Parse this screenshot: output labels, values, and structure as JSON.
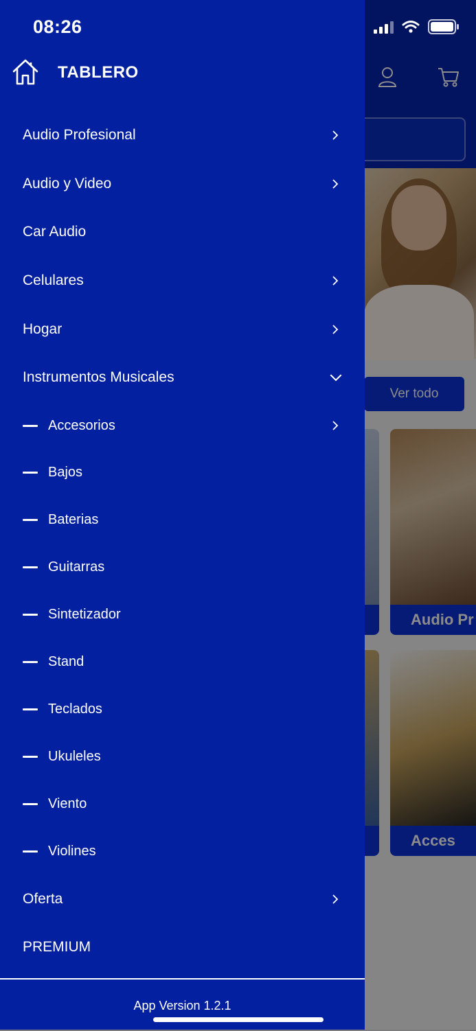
{
  "status_bar": {
    "time": "08:26"
  },
  "background": {
    "ver_todo_label": "Ver todo",
    "card_labels": [
      "Audio Pr",
      "Acces"
    ]
  },
  "drawer": {
    "title": "TABLERO",
    "items": [
      {
        "label": "Audio Profesional",
        "chevron": "right"
      },
      {
        "label": "Audio y Video",
        "chevron": "right"
      },
      {
        "label": "Car Audio",
        "chevron": "none"
      },
      {
        "label": "Celulares",
        "chevron": "right"
      },
      {
        "label": "Hogar",
        "chevron": "right"
      },
      {
        "label": "Instrumentos Musicales",
        "chevron": "down",
        "expanded": true
      }
    ],
    "subitems": [
      {
        "label": "Accesorios",
        "chevron": "right"
      },
      {
        "label": "Bajos"
      },
      {
        "label": "Baterias"
      },
      {
        "label": "Guitarras"
      },
      {
        "label": "Sintetizador"
      },
      {
        "label": "Stand"
      },
      {
        "label": "Teclados"
      },
      {
        "label": "Ukuleles"
      },
      {
        "label": "Viento"
      },
      {
        "label": "Violines"
      }
    ],
    "items_after": [
      {
        "label": "Oferta",
        "chevron": "right"
      },
      {
        "label": "PREMIUM",
        "chevron": "none"
      }
    ],
    "footer": {
      "app_version": "App Version 1.2.1"
    }
  },
  "colors": {
    "drawer_bg": "#02209f",
    "accent": "#0a32d6",
    "text": "#ffffff"
  },
  "icons": [
    "home-icon",
    "user-icon",
    "cart-icon",
    "chevron-right-icon",
    "chevron-down-icon",
    "signal-icon",
    "wifi-icon",
    "battery-icon"
  ]
}
